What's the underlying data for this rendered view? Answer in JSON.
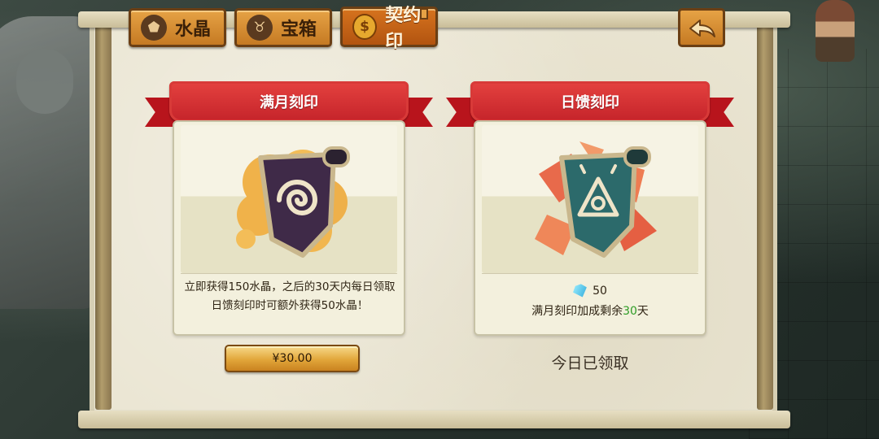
{
  "tabs": [
    {
      "label": "水晶",
      "icon": "crystal-ore-icon",
      "glyph": "⬟"
    },
    {
      "label": "宝箱",
      "icon": "money-bag-icon",
      "glyph": "♉"
    },
    {
      "label": "契约印",
      "icon": "coin-icon",
      "glyph": "$"
    }
  ],
  "active_tab": "契约印",
  "back_button": {
    "icon": "back-arrow-icon"
  },
  "cards": {
    "left": {
      "title": "满月刻印",
      "art": "moon-seal-scroll",
      "description": "立即获得150水晶，之后的30天内每日领取日馈刻印时可额外获得50水晶！",
      "price": "¥30.00"
    },
    "right": {
      "title": "日馈刻印",
      "art": "sun-seal-scroll",
      "gem_amount": "50",
      "bonus_prefix": "满月刻印加成剩余",
      "bonus_days": "30",
      "bonus_suffix": "天",
      "status": "今日已领取"
    }
  },
  "colors": {
    "banner_red": "#d8302f",
    "tab_orange": "#d8892f",
    "active_tab": "#c2601a",
    "highlight_green": "#2e9c26",
    "panel_bg": "#eae5d2"
  }
}
